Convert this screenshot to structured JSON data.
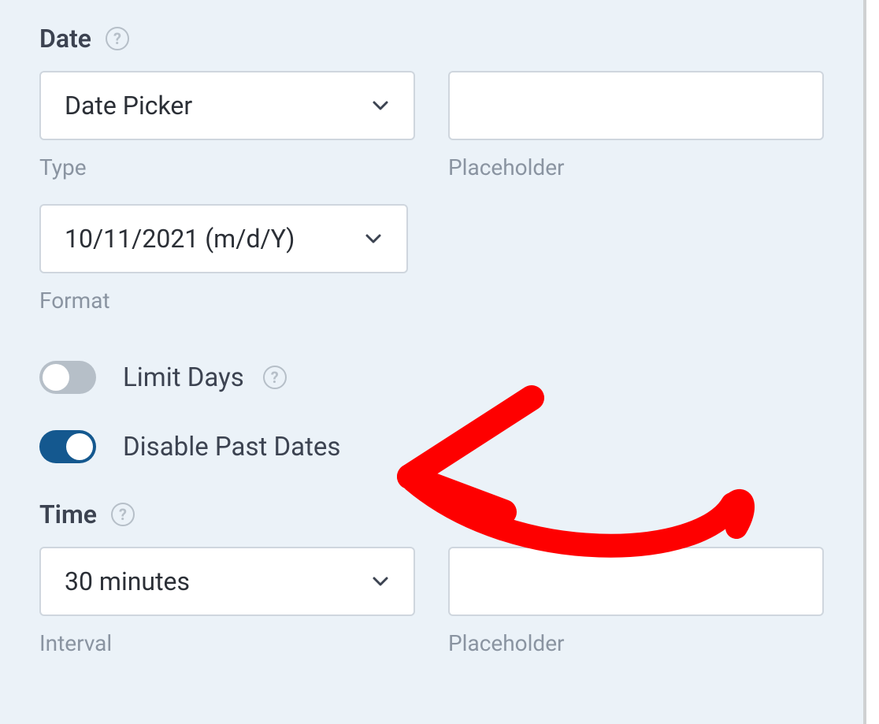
{
  "date": {
    "heading": "Date",
    "type": {
      "value": "Date Picker",
      "label": "Type"
    },
    "placeholder": {
      "value": "",
      "label": "Placeholder"
    },
    "format": {
      "value": "10/11/2021 (m/d/Y)",
      "label": "Format"
    },
    "toggles": {
      "limit_days": {
        "label": "Limit Days",
        "on": false
      },
      "disable_past_dates": {
        "label": "Disable Past Dates",
        "on": true
      }
    }
  },
  "time": {
    "heading": "Time",
    "interval": {
      "value": "30 minutes",
      "label": "Interval"
    },
    "placeholder": {
      "value": "",
      "label": "Placeholder"
    }
  },
  "glyphs": {
    "help": "?"
  },
  "annotation": {
    "color": "#fe0000"
  }
}
